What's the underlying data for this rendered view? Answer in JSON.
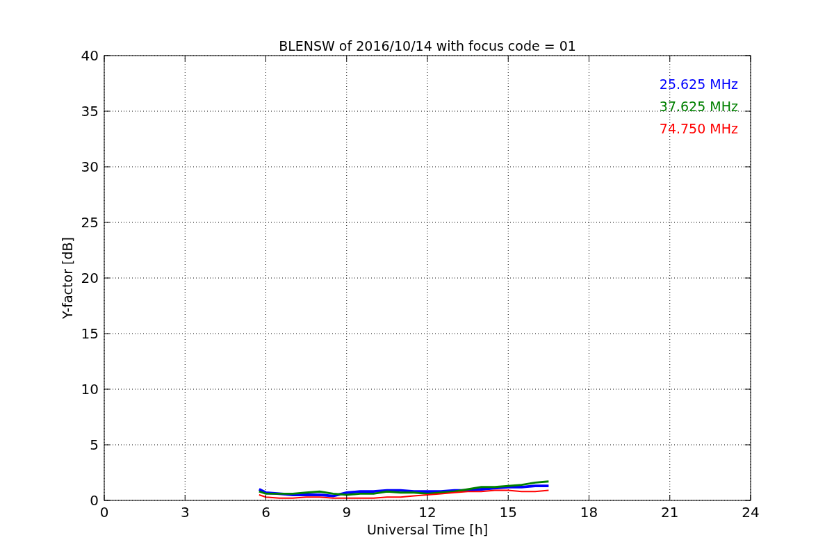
{
  "figure": {
    "chart_data": {
      "type": "line",
      "title": "BLENSW of 2016/10/14 with focus code = 01",
      "xlabel": "Universal Time [h]",
      "ylabel": "Y-factor [dB]",
      "x": [
        5.75,
        6,
        6.5,
        7,
        7.5,
        8,
        8.5,
        9,
        9.5,
        10,
        10.5,
        11,
        11.5,
        12,
        12.5,
        13,
        13.5,
        14,
        14.5,
        15,
        15.5,
        16,
        16.5
      ],
      "series": [
        {
          "name": "25.625 MHz",
          "color": "#0000ff",
          "values": [
            1.0,
            0.7,
            0.6,
            0.5,
            0.5,
            0.5,
            0.4,
            0.7,
            0.8,
            0.8,
            0.9,
            0.9,
            0.8,
            0.8,
            0.8,
            0.9,
            0.9,
            1.0,
            1.1,
            1.2,
            1.2,
            1.3,
            1.3
          ]
        },
        {
          "name": "37.625 MHz",
          "color": "#008000",
          "values": [
            0.8,
            0.6,
            0.6,
            0.6,
            0.7,
            0.8,
            0.6,
            0.5,
            0.6,
            0.6,
            0.8,
            0.7,
            0.7,
            0.6,
            0.7,
            0.8,
            1.0,
            1.2,
            1.2,
            1.3,
            1.4,
            1.6,
            1.7
          ]
        },
        {
          "name": "74.750 MHz",
          "color": "#ff0000",
          "values": [
            0.5,
            0.3,
            0.2,
            0.2,
            0.3,
            0.3,
            0.2,
            0.2,
            0.2,
            0.2,
            0.3,
            0.3,
            0.4,
            0.5,
            0.6,
            0.7,
            0.8,
            0.8,
            0.9,
            0.9,
            0.8,
            0.8,
            0.9
          ]
        }
      ],
      "grid": true,
      "xlim": [
        0,
        24
      ],
      "ylim": [
        0,
        40
      ],
      "xticks": [
        0,
        3,
        6,
        9,
        12,
        15,
        18,
        21,
        24
      ],
      "yticks": [
        0,
        5,
        10,
        15,
        20,
        25,
        30,
        35,
        40
      ]
    }
  }
}
